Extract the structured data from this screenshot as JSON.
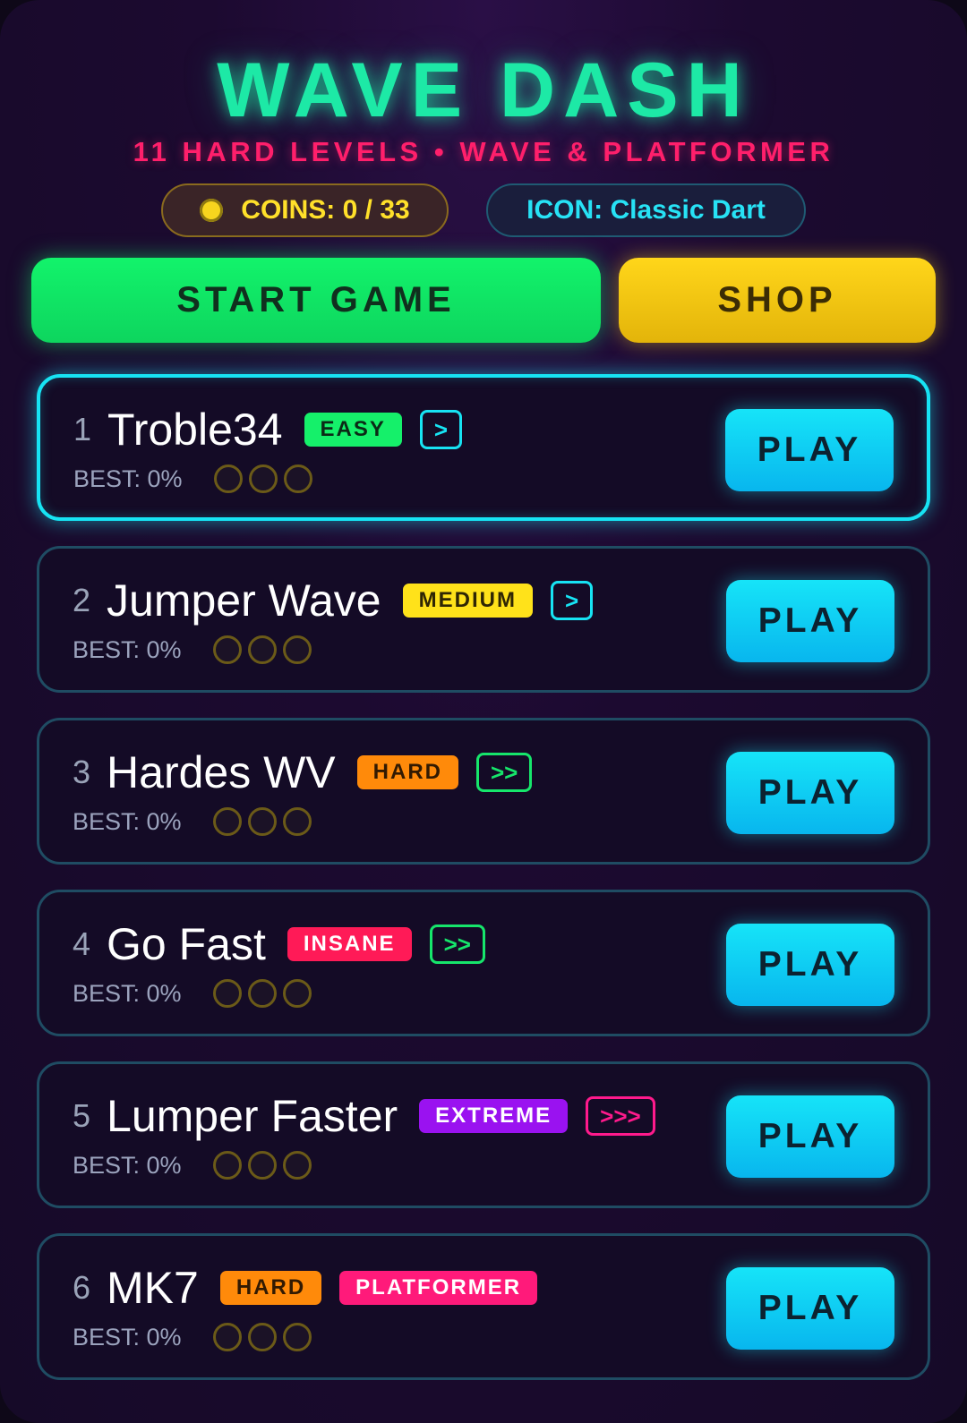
{
  "header": {
    "title": "WAVE DASH",
    "subtitle": "11 HARD LEVELS • WAVE & PLATFORMER",
    "coins": "COINS: 0 / 33",
    "icon": "ICON: Classic Dart"
  },
  "actions": {
    "start": "START GAME",
    "shop": "SHOP"
  },
  "colors": {
    "title": "#1de9a6",
    "subtitle": "#ff1f6b",
    "start_button": "#12f36b",
    "shop_button": "#ffd61a",
    "play_button": "#16e4f8",
    "active_card_border": "#17e3f3"
  },
  "levels": [
    {
      "number": "1",
      "name": "Troble34",
      "difficulty": "EASY",
      "difficulty_color": "#15f06a",
      "difficulty_text_color": "#0b2a16",
      "speed": ">",
      "speed_color": "#17e3f3",
      "best": "BEST: 0%",
      "coins_collected": 0,
      "coins_total": 3,
      "play": "PLAY",
      "active": true
    },
    {
      "number": "2",
      "name": "Jumper Wave",
      "difficulty": "MEDIUM",
      "difficulty_color": "#ffe21a",
      "difficulty_text_color": "#2f2604",
      "speed": ">",
      "speed_color": "#17e3f3",
      "best": "BEST: 0%",
      "coins_collected": 0,
      "coins_total": 3,
      "play": "PLAY",
      "active": false
    },
    {
      "number": "3",
      "name": "Hardes WV",
      "difficulty": "HARD",
      "difficulty_color": "#ff8a0a",
      "difficulty_text_color": "#321a02",
      "speed": ">>",
      "speed_color": "#16e66b",
      "best": "BEST: 0%",
      "coins_collected": 0,
      "coins_total": 3,
      "play": "PLAY",
      "active": false
    },
    {
      "number": "4",
      "name": "Go Fast",
      "difficulty": "INSANE",
      "difficulty_color": "#ff1a57",
      "difficulty_text_color": "#ffffff",
      "speed": ">>",
      "speed_color": "#16e66b",
      "best": "BEST: 0%",
      "coins_collected": 0,
      "coins_total": 3,
      "play": "PLAY",
      "active": false
    },
    {
      "number": "5",
      "name": "Lumper Faster",
      "difficulty": "EXTREME",
      "difficulty_color": "#9a12f0",
      "difficulty_text_color": "#ffffff",
      "speed": ">>>",
      "speed_color": "#ff1a8c",
      "best": "BEST: 0%",
      "coins_collected": 0,
      "coins_total": 3,
      "play": "PLAY",
      "active": false
    },
    {
      "number": "6",
      "name": "MK7",
      "difficulty": "HARD",
      "difficulty_color": "#ff8a0a",
      "difficulty_text_color": "#321a02",
      "tag": "PLATFORMER",
      "tag_color": "#ff1a7a",
      "tag_text_color": "#ffffff",
      "best": "BEST: 0%",
      "coins_collected": 0,
      "coins_total": 3,
      "play": "PLAY",
      "active": false
    }
  ]
}
